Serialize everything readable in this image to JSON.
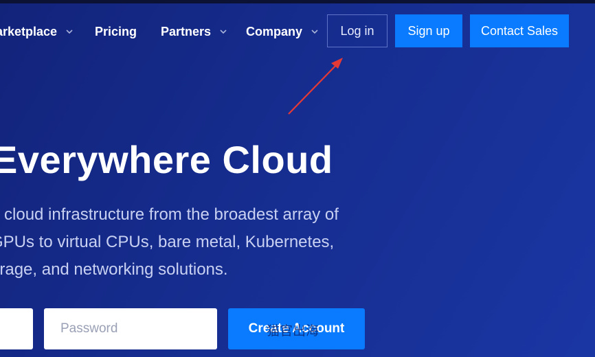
{
  "nav": {
    "items": [
      {
        "label": "arketplace",
        "has_dropdown": true
      },
      {
        "label": "Pricing",
        "has_dropdown": false
      },
      {
        "label": "Partners",
        "has_dropdown": true
      },
      {
        "label": "Company",
        "has_dropdown": true
      }
    ],
    "login_label": "Log in",
    "signup_label": "Sign up",
    "contact_label": "Contact Sales"
  },
  "hero": {
    "title": "Everywhere Cloud",
    "subtitle_lines": [
      "d cloud infrastructure from the broadest array of",
      "GPUs to virtual CPUs, bare metal, Kubernetes,",
      "orage, and networking solutions."
    ]
  },
  "form": {
    "email_value": "",
    "password_placeholder": "Password",
    "submit_label": "Create Account"
  },
  "watermark": "猫官出海",
  "colors": {
    "accent": "#0a7bff",
    "background": "#162d8f",
    "annotation_arrow": "#e53935"
  },
  "icons": {
    "dropdown": "chevron-down-icon",
    "annotation": "red-arrow"
  }
}
